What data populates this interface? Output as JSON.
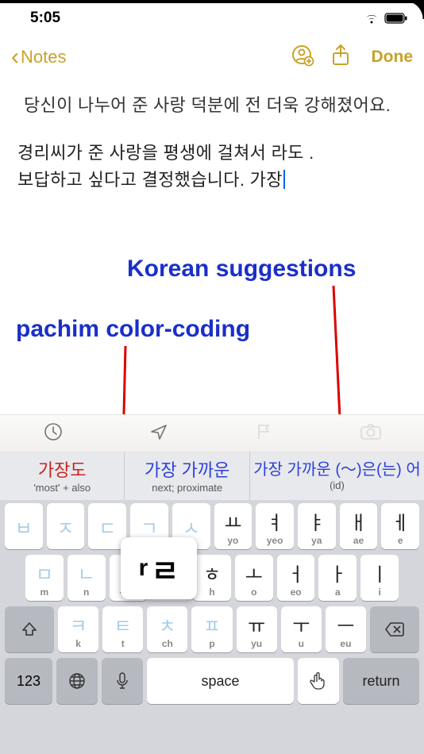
{
  "status": {
    "time": "5:05"
  },
  "nav": {
    "back_label": "Notes",
    "done_label": "Done"
  },
  "note": {
    "p1": "당신이 나누어 준 사랑 덕분에 전 더욱 강해졌어요.",
    "p2_a": "경리씨가 준 사랑을 평생에 걸쳐서  라도 .",
    "p2_b": "보답하고 싶다고 결정했습니다. ",
    "p2_last": "가장"
  },
  "annotations": {
    "label1": "Korean suggestions",
    "label2": "pachim color-coding"
  },
  "suggestions": [
    {
      "k": "가장도",
      "e": "'most' + also"
    },
    {
      "k": "가장 가까운",
      "e": "next; proximate"
    },
    {
      "k": "가장 가까운 (～)은(는) 어",
      "e": "(id)"
    }
  ],
  "keyboard": {
    "popup_r": "r",
    "popup_h": "ㄹ",
    "row1": [
      {
        "h": "ㅂ",
        "r": ""
      },
      {
        "h": "ㅈ",
        "r": ""
      },
      {
        "h": "ㄷ",
        "r": ""
      },
      {
        "h": "ㄱ",
        "r": ""
      },
      {
        "h": "ㅅ",
        "r": ""
      },
      {
        "h": "ㅛ",
        "r": "yo",
        "d": 1
      },
      {
        "h": "ㅕ",
        "r": "yeo",
        "d": 1
      },
      {
        "h": "ㅑ",
        "r": "ya",
        "d": 1
      },
      {
        "h": "ㅐ",
        "r": "ae",
        "d": 1
      },
      {
        "h": "ㅔ",
        "r": "e",
        "d": 1
      }
    ],
    "row2": [
      {
        "h": "ㅁ",
        "r": "m"
      },
      {
        "h": "ㄴ",
        "r": "n"
      },
      {
        "h": "ㅇ",
        "r": "-/ng"
      },
      {
        "h": "ㄹ",
        "r": "",
        "shadow": 1
      },
      {
        "h": "ㅎ",
        "r": "h",
        "d": 1
      },
      {
        "h": "ㅗ",
        "r": "o",
        "d": 1
      },
      {
        "h": "ㅓ",
        "r": "eo",
        "d": 1
      },
      {
        "h": "ㅏ",
        "r": "a",
        "d": 1
      },
      {
        "h": "ㅣ",
        "r": "i",
        "d": 1
      }
    ],
    "row3": [
      {
        "h": "ㅋ",
        "r": "k"
      },
      {
        "h": "ㅌ",
        "r": "t"
      },
      {
        "h": "ㅊ",
        "r": "ch"
      },
      {
        "h": "ㅍ",
        "r": "p"
      },
      {
        "h": "ㅠ",
        "r": "yu",
        "d": 1
      },
      {
        "h": "ㅜ",
        "r": "u",
        "d": 1
      },
      {
        "h": "ㅡ",
        "r": "eu",
        "d": 1
      }
    ],
    "space_label": "space",
    "return_label": "return",
    "num_label": "123"
  }
}
